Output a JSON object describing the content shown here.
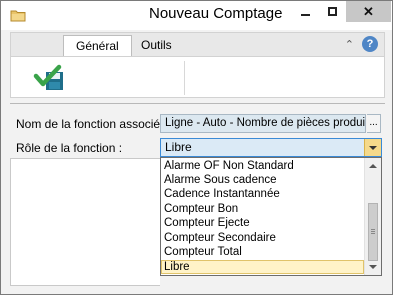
{
  "window": {
    "title": "Nouveau Comptage",
    "icon": "folder-icon",
    "close_label": "✕"
  },
  "ribbon": {
    "tabs": [
      {
        "label": "Général",
        "active": true
      },
      {
        "label": "Outils",
        "active": false
      }
    ],
    "collapse_label": "⌃",
    "help_label": "?",
    "save_icon": "save-check-icon"
  },
  "form": {
    "function_label": "Nom de la fonction associée :",
    "function_value": "Ligne - Auto - Nombre de pièces produites",
    "browse_label": "...",
    "role_label": "Rôle de la fonction :",
    "role_value": "Libre"
  },
  "dropdown": {
    "options": [
      "Alarme OF Non Standard",
      "Alarme Sous cadence",
      "Cadence Instantannée",
      "Compteur Bon",
      "Compteur Ejecte",
      "Compteur Secondaire",
      "Compteur Total",
      "Libre"
    ],
    "selected_index": 7
  },
  "colors": {
    "accent": "#3a8ad6",
    "check_green": "#3aa34a",
    "save_teal": "#1f6e8a",
    "selected_item": "#fff3c8",
    "close_button": "#c7c7c7"
  }
}
